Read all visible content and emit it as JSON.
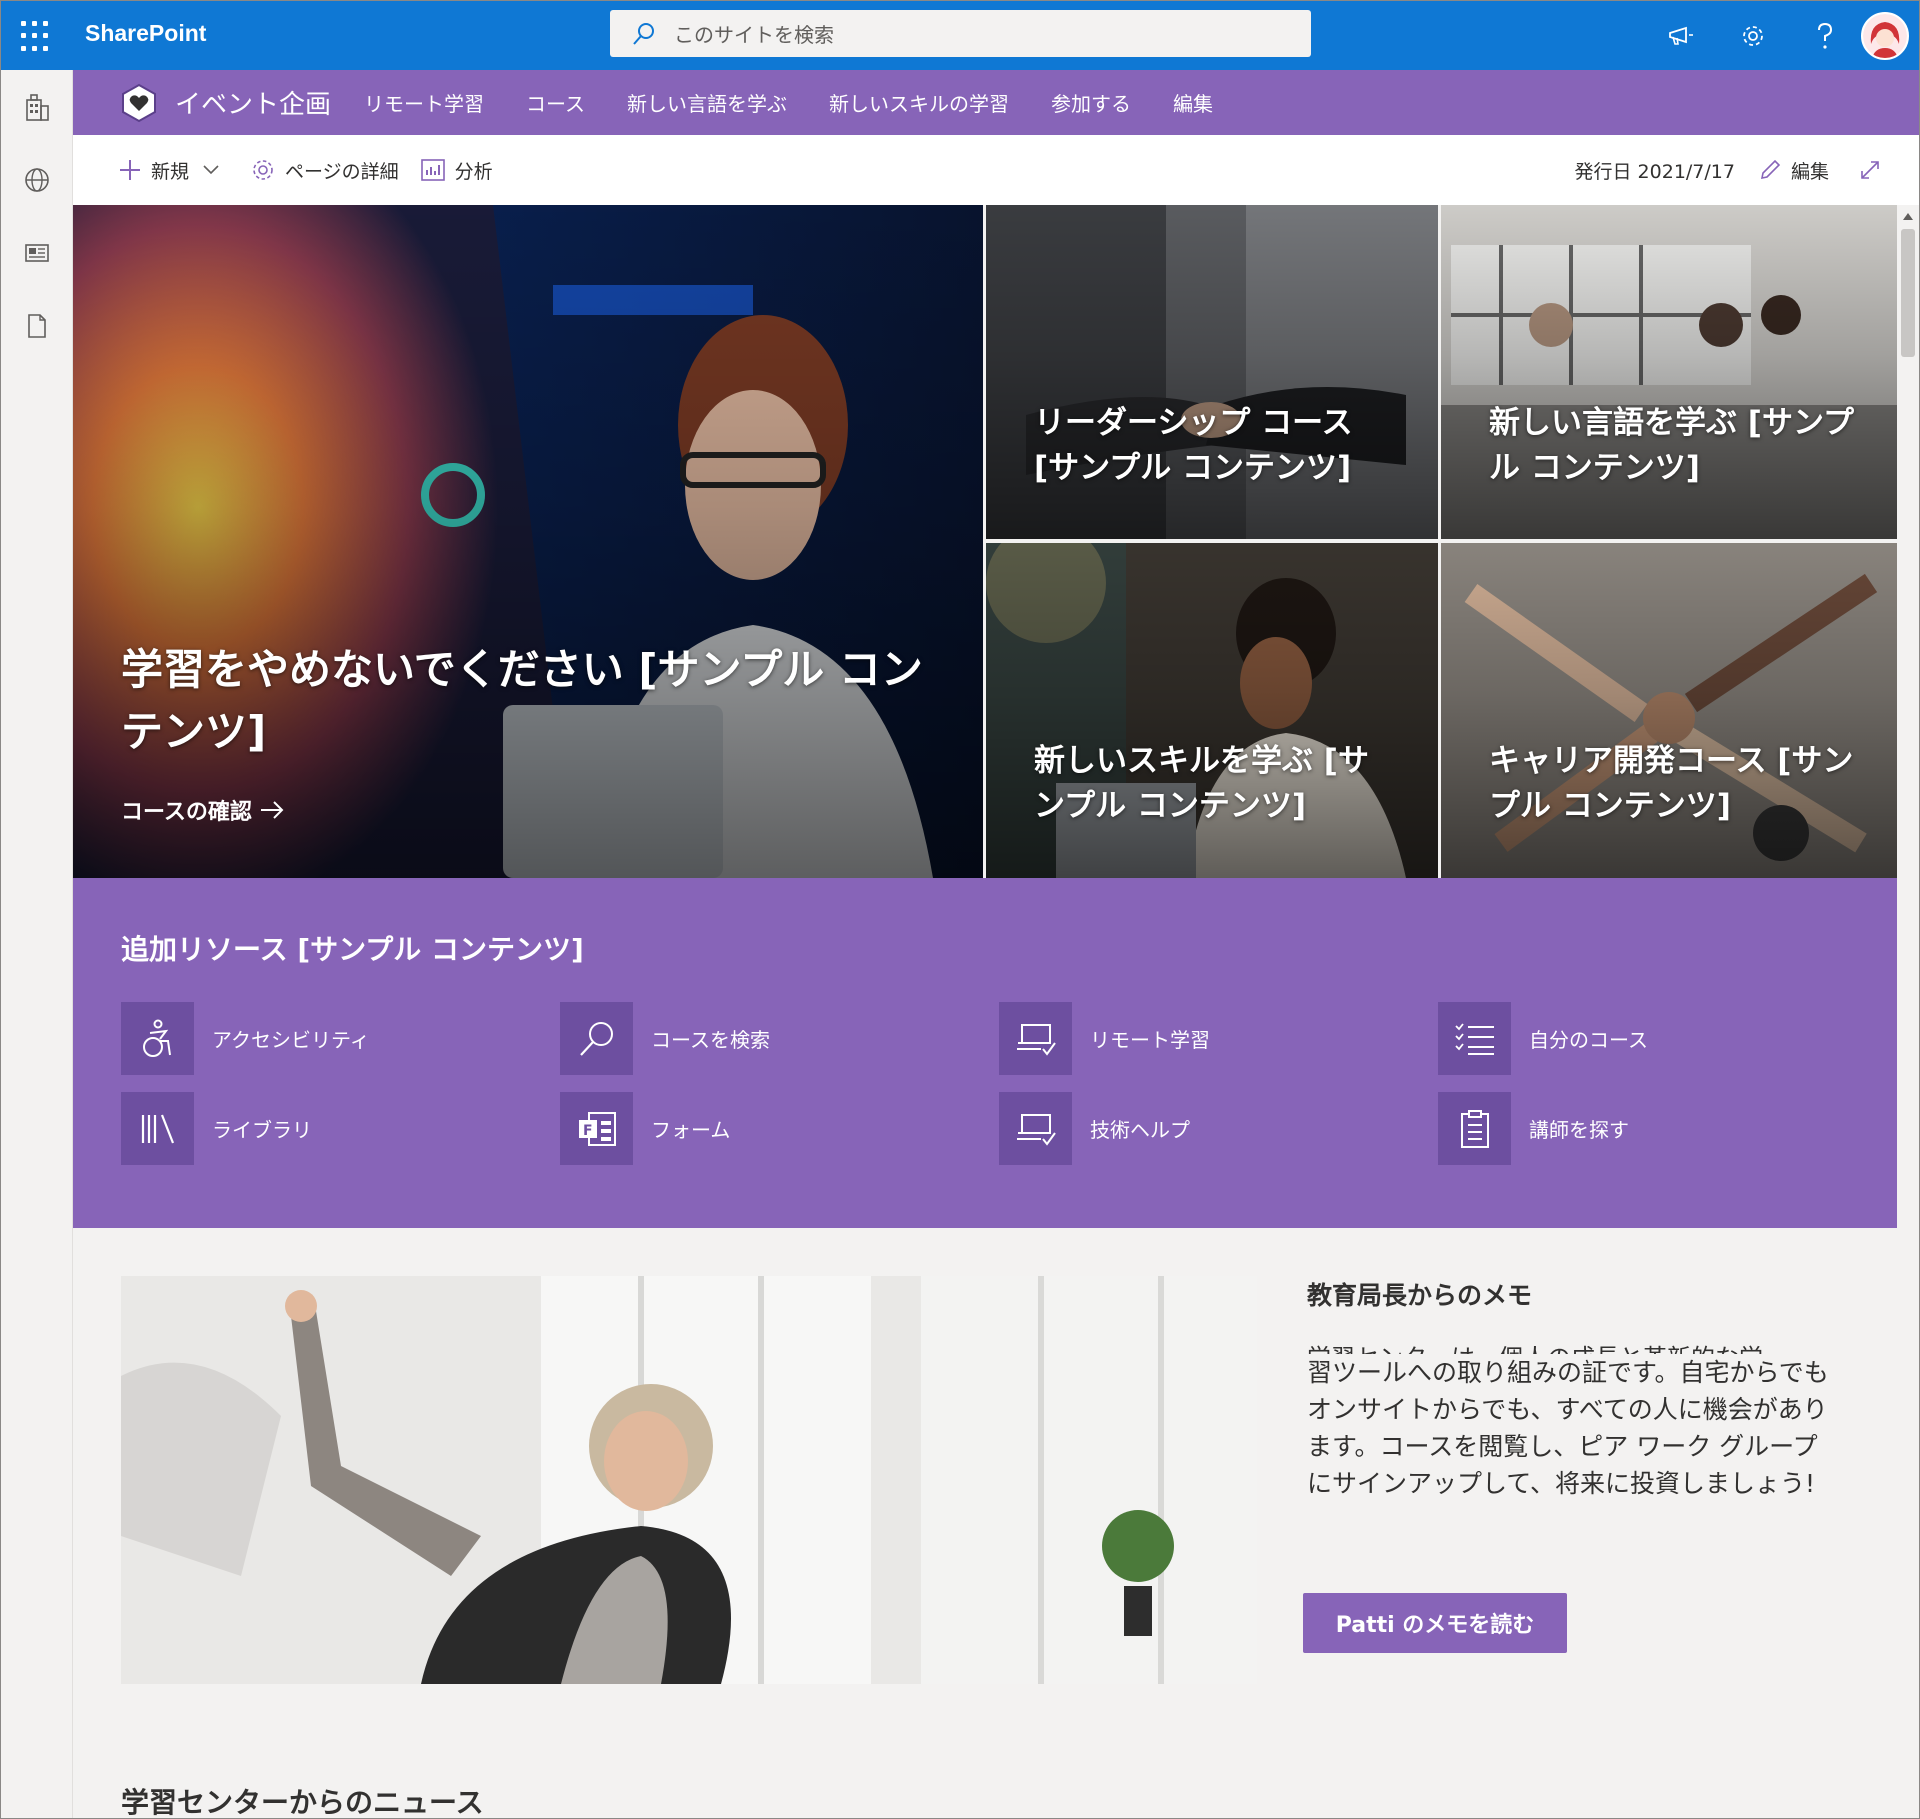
{
  "suite": {
    "brand": "SharePoint",
    "search_placeholder": "このサイトを検索"
  },
  "hub": {
    "site_name": "イベント企画",
    "nav": [
      "リモート学習",
      "コース",
      "新しい言語を学ぶ",
      "新しいスキルの学習",
      "参加する",
      "編集"
    ]
  },
  "commands": {
    "new": "新規",
    "page_details": "ページの詳細",
    "analytics": "分析",
    "published": "発行日 2021/7/17",
    "edit": "編集"
  },
  "hero": {
    "main_title": "学習をやめないでください [サンプル コンテンツ]",
    "main_link": "コースの確認",
    "tiles": [
      "リーダーシップ コース [サンプル コンテンツ]",
      "新しい言語を学ぶ [サンプル コンテンツ]",
      "新しいスキルを学ぶ [サンプル コンテンツ]",
      "キャリア開発コース [サンプル コンテンツ]"
    ]
  },
  "quick_links": {
    "title": "追加リソース [サンプル コンテンツ]",
    "items": [
      {
        "label": "アクセシビリティ",
        "icon": "accessibility-icon"
      },
      {
        "label": "コースを検索",
        "icon": "search-icon"
      },
      {
        "label": "リモート学習",
        "icon": "laptop-check-icon"
      },
      {
        "label": "自分のコース",
        "icon": "list-icon"
      },
      {
        "label": "ライブラリ",
        "icon": "library-icon"
      },
      {
        "label": "フォーム",
        "icon": "forms-icon"
      },
      {
        "label": "技術ヘルプ",
        "icon": "laptop-check-icon"
      },
      {
        "label": "講師を探す",
        "icon": "clipboard-icon"
      }
    ]
  },
  "memo": {
    "title": "教育局長からのメモ",
    "clipped_line": "学習センターは、個人の成長と革新的な学",
    "body": "習ツールへの取り組みの証です。自宅からでもオンサイトからでも、すべての人に機会があります。コースを閲覧し、ピア ワーク グループにサインアップして、将来に投資しましょう!",
    "button": "Patti のメモを読む"
  },
  "news_title": "学習センターからのニュース",
  "colors": {
    "suite_blue": "#0f78d4",
    "theme_purple": "#8764b8",
    "icon_tile_purple": "#6d4fa0"
  }
}
